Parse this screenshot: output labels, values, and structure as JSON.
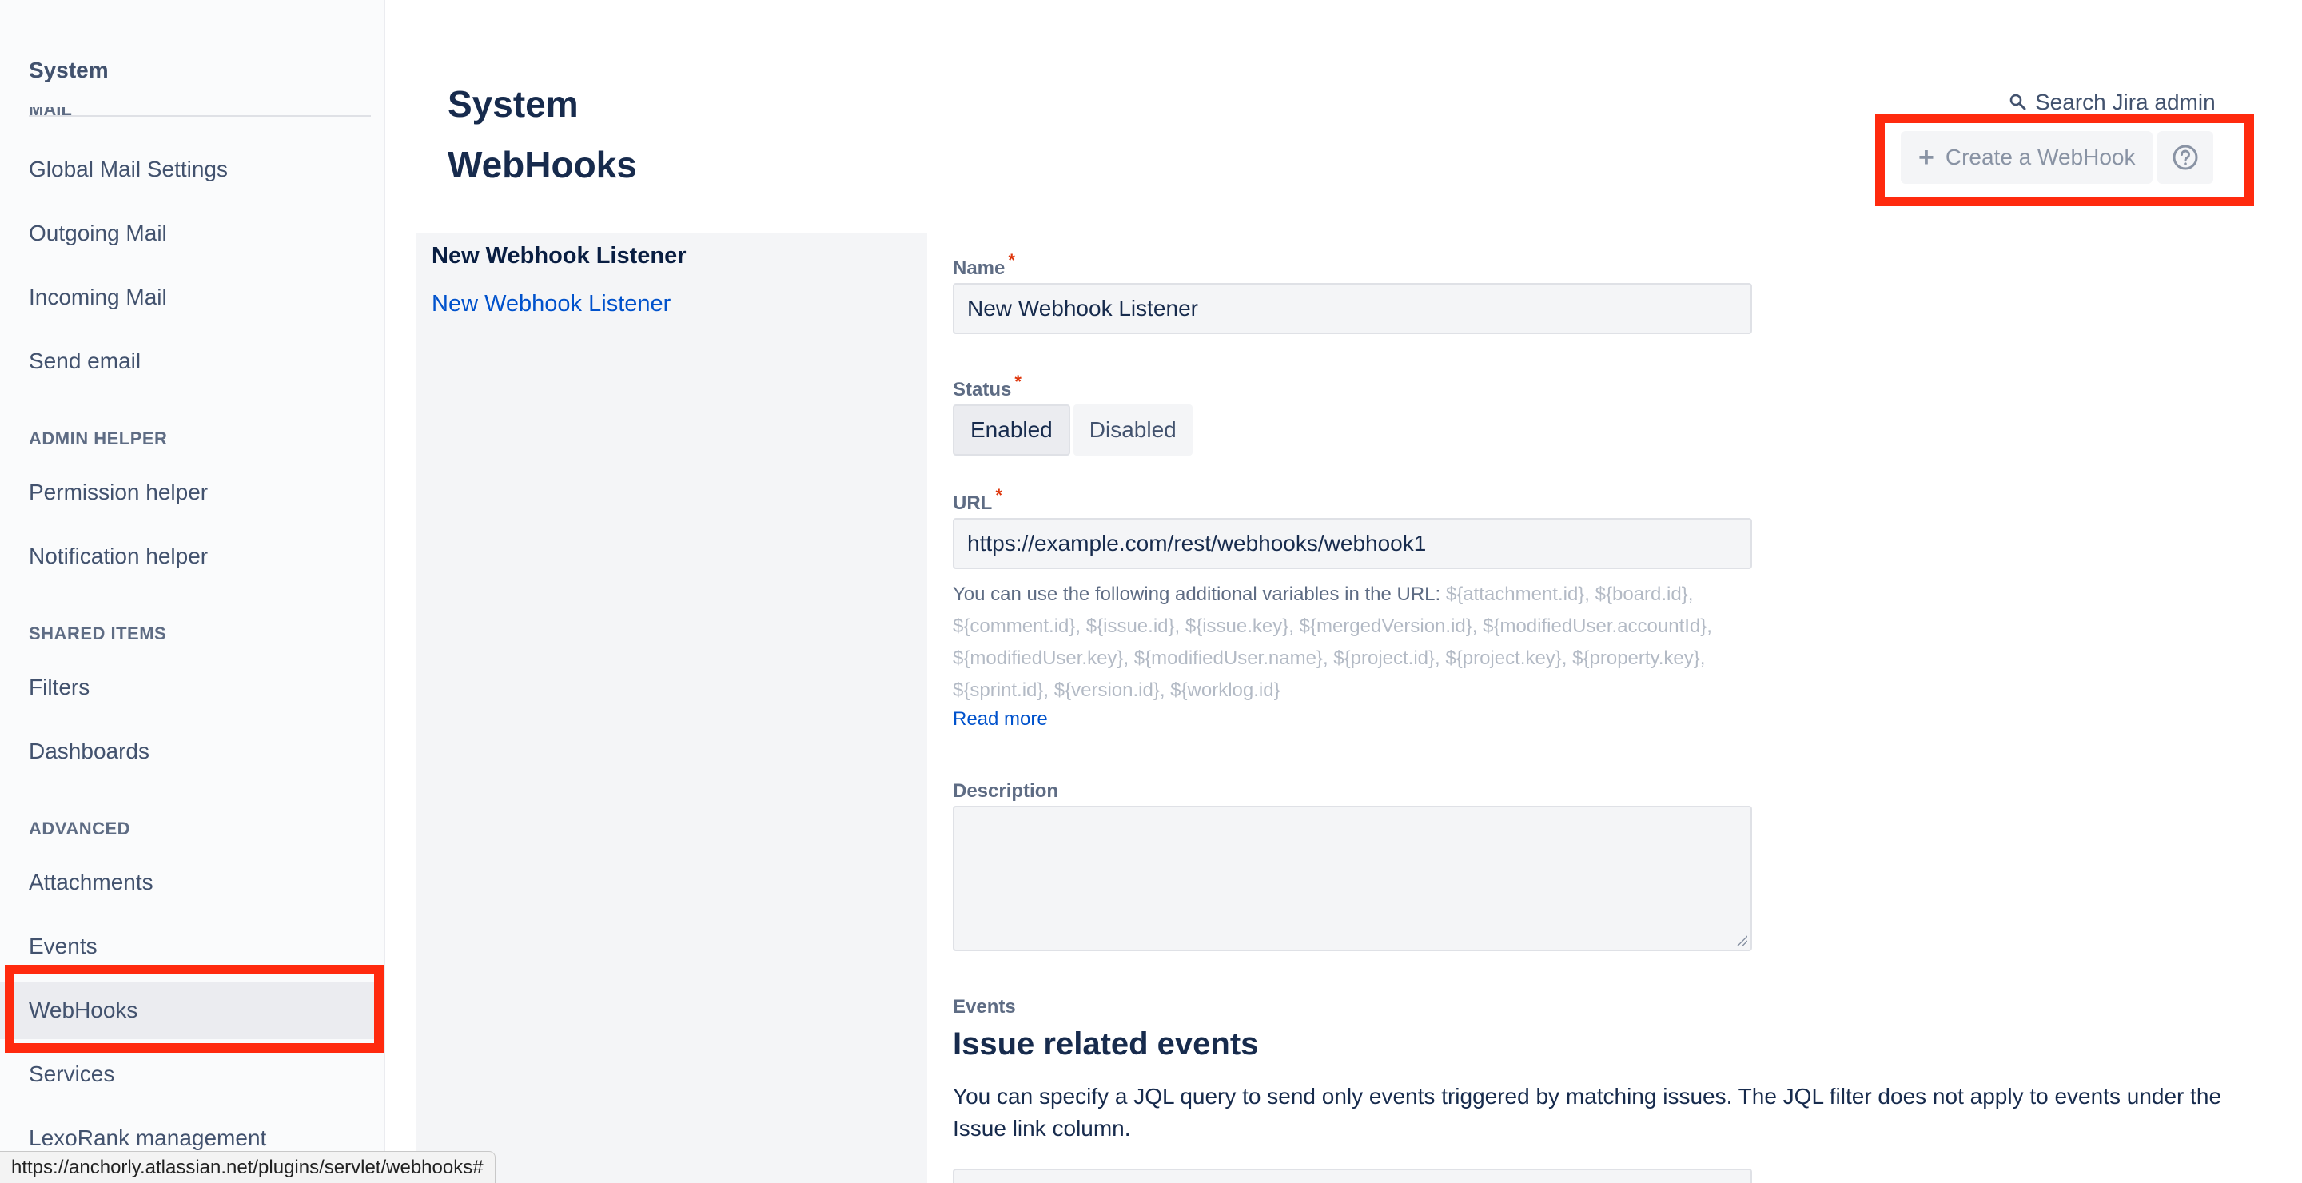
{
  "sidebar": {
    "title": "System",
    "clipped_section": "MAIL",
    "items": [
      {
        "label": "Global Mail Settings"
      },
      {
        "label": "Outgoing Mail"
      },
      {
        "label": "Incoming Mail"
      },
      {
        "label": "Send email"
      },
      {
        "label": "Permission helper"
      },
      {
        "label": "Notification helper"
      },
      {
        "label": "Filters"
      },
      {
        "label": "Dashboards"
      },
      {
        "label": "Attachments"
      },
      {
        "label": "Events"
      },
      {
        "label": "WebHooks"
      },
      {
        "label": "Services"
      },
      {
        "label": "LexoRank management"
      }
    ],
    "sections": {
      "admin_helper": "ADMIN HELPER",
      "shared_items": "SHARED ITEMS",
      "advanced": "ADVANCED"
    },
    "active_item": "WebHooks"
  },
  "header": {
    "title_line1": "System",
    "title_line2": "WebHooks",
    "search_label": "Search Jira admin",
    "create_button": "Create a WebHook"
  },
  "listener_list": {
    "heading": "New Webhook Listener",
    "link": "New Webhook Listener"
  },
  "form": {
    "name_label": "Name",
    "name_value": "New Webhook Listener",
    "required_mark": "*",
    "status_label": "Status",
    "status_options": [
      "Enabled",
      "Disabled"
    ],
    "status_selected": "Enabled",
    "url_label": "URL",
    "url_value": "https://example.com/rest/webhooks/webhook1",
    "url_help_prefix": "You can use the following additional variables in the URL:",
    "url_help_vars": "${attachment.id}, ${board.id}, ${comment.id}, ${issue.id}, ${issue.key}, ${mergedVersion.id}, ${modifiedUser.accountId}, ${modifiedUser.key}, ${modifiedUser.name}, ${project.id}, ${project.key}, ${property.key}, ${sprint.id}, ${version.id}, ${worklog.id}",
    "read_more": "Read more",
    "description_label": "Description",
    "events_label": "Events",
    "issue_events_heading": "Issue related events",
    "issue_events_desc": "You can specify a JQL query to send only events triggered by matching issues. The JQL filter does not apply to events under the Issue link column."
  },
  "status_bar": {
    "url": "https://anchorly.atlassian.net/plugins/servlet/webhooks#"
  },
  "colors": {
    "highlight": "#ff2a0e",
    "link": "#0052cc",
    "required": "#de350b"
  }
}
